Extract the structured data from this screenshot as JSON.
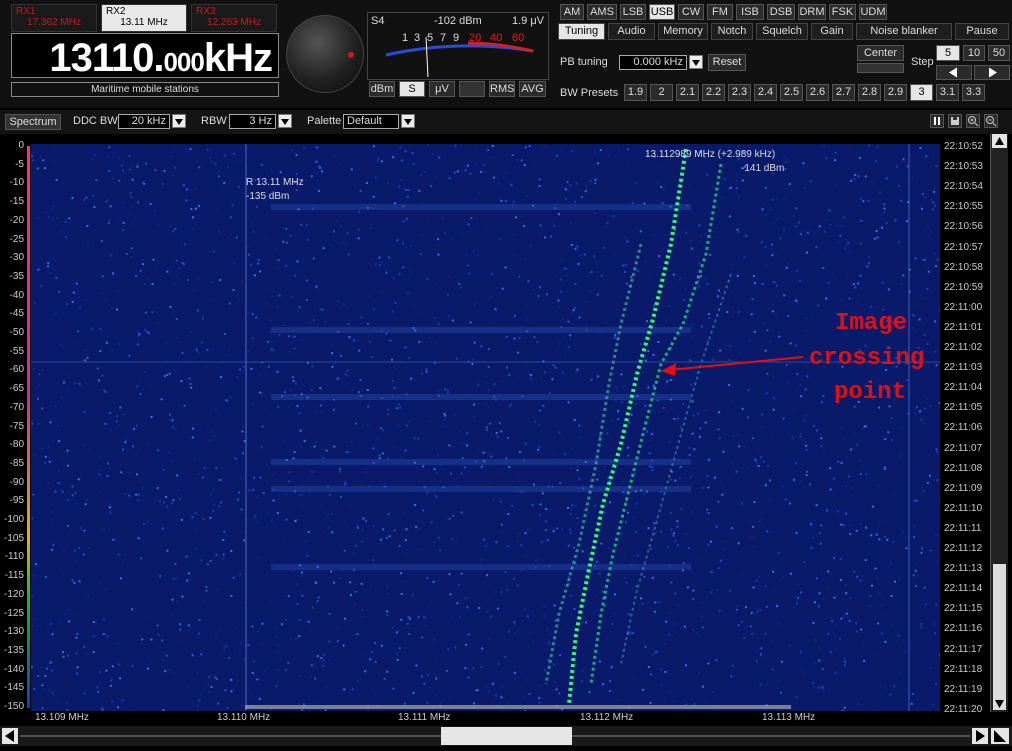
{
  "receivers": [
    {
      "name": "RX1",
      "freq": "17.362 MHz"
    },
    {
      "name": "RX2",
      "freq": "13.11 MHz"
    },
    {
      "name": "RX3",
      "freq": "12.263 MHz"
    }
  ],
  "frequency": {
    "main": "13110.",
    "fraction": "000",
    "unit": "kHz"
  },
  "band_label": "Maritime mobile stations",
  "meter": {
    "s_reading": "S4",
    "dbm": "-102 dBm",
    "uv": "1.9 μV",
    "scale": [
      "1",
      "3",
      "5",
      "7",
      "9",
      "20",
      "40",
      "60"
    ],
    "buttons": [
      "dBm",
      "S",
      "μV",
      "",
      "RMS",
      "AVG"
    ],
    "active": "S"
  },
  "modes": {
    "items": [
      "AM",
      "AMS",
      "LSB",
      "USB",
      "CW",
      "FM",
      "ISB",
      "DSB",
      "DRM",
      "FSK",
      "UDM"
    ],
    "active": "USB"
  },
  "tabs": {
    "items": [
      "Tuning",
      "Audio",
      "Memory",
      "Notch",
      "Squelch",
      "Gain",
      "Noise blanker",
      "Pause"
    ],
    "active": "Tuning"
  },
  "tuning": {
    "pb_label": "PB tuning",
    "pb_value": "0.000 kHz",
    "reset": "Reset",
    "center": "Center",
    "step_label": "Step",
    "steps": [
      "5",
      "10",
      "50"
    ],
    "active_step": "5"
  },
  "bw_presets": {
    "label": "BW Presets",
    "items": [
      "1.9",
      "2",
      "2.1",
      "2.2",
      "2.3",
      "2.4",
      "2.5",
      "2.6",
      "2.7",
      "2.8",
      "2.9",
      "3",
      "3.1",
      "3.3"
    ],
    "active": "3"
  },
  "spectrum_bar": {
    "spectrum_btn": "Spectrum",
    "ddc_label": "DDC BW",
    "ddc_value": "20 kHz",
    "rbw_label": "RBW",
    "rbw_value": "3 Hz",
    "palette_label": "Palette",
    "palette_value": "Default"
  },
  "waterfall": {
    "y_labels": [
      "0",
      "-5",
      "-10",
      "-15",
      "-20",
      "-25",
      "-30",
      "-35",
      "-40",
      "-45",
      "-50",
      "-55",
      "-60",
      "-65",
      "-70",
      "-75",
      "-80",
      "-85",
      "-90",
      "-95",
      "-100",
      "-105",
      "-110",
      "-115",
      "-120",
      "-125",
      "-130",
      "-135",
      "-140",
      "-145",
      "-150"
    ],
    "times": [
      "22:10:52",
      "22:10:53",
      "22:10:54",
      "22:10:55",
      "22:10:56",
      "22:10:57",
      "22:10:58",
      "22:10:59",
      "22:11:00",
      "22:11:01",
      "22:11:02",
      "22:11:03",
      "22:11:04",
      "22:11:05",
      "22:11:06",
      "22:11:07",
      "22:11:08",
      "22:11:09",
      "22:11:10",
      "22:11:11",
      "22:11:12",
      "22:11:13",
      "22:11:14",
      "22:11:15",
      "22:11:16",
      "22:11:17",
      "22:11:18",
      "22:11:19",
      "22:11:20"
    ],
    "x_labels": [
      "13.109 MHz",
      "13.110 MHz",
      "13.111 MHz",
      "13.112 MHz",
      "13.113 MHz"
    ],
    "marker_r": {
      "line1": "R 13.11 MHz",
      "line2": "-135 dBm"
    },
    "marker_cursor": {
      "line1": "13.112989 MHz (+2.989 kHz)",
      "line2": "-141 dBm"
    },
    "annotation": [
      "Image",
      "crossing",
      "point"
    ],
    "colors": {
      "bg": "#0a1a6a",
      "trace": "#35ff6a",
      "annotation": "#e01010"
    }
  }
}
